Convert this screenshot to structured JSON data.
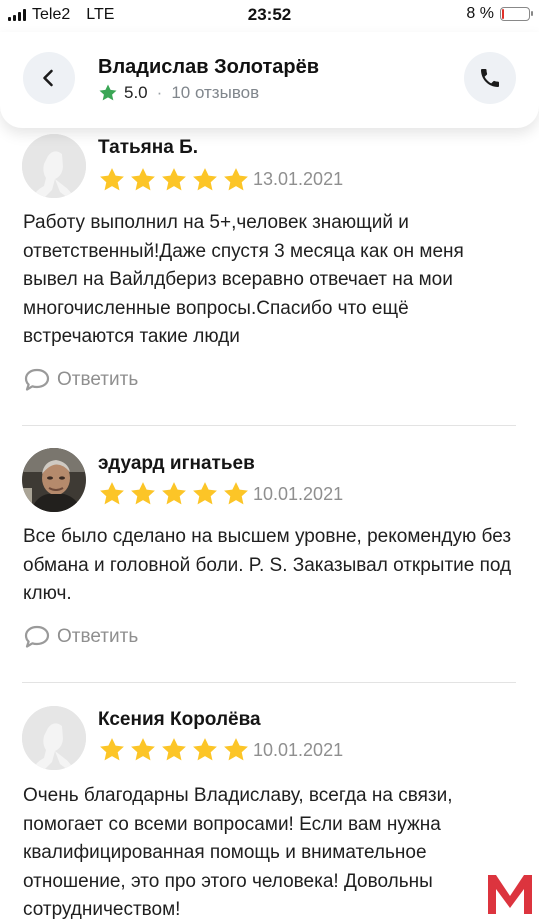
{
  "status_bar": {
    "carrier": "Tele2",
    "network": "LTE",
    "time": "23:52",
    "battery_text": "8 %",
    "battery_level": 0.08,
    "battery_color": "#e0312a"
  },
  "header": {
    "name": "Владислав Золотарёв",
    "rating": "5.0",
    "separator": "·",
    "reviews_count": "10 отзывов",
    "back_icon": "chevron-left-icon",
    "call_icon": "phone-icon"
  },
  "colors": {
    "star": "#fcc527",
    "rating_star": "#3aa655",
    "muted_text": "#8f8f8f"
  },
  "reviews": [
    {
      "name": "Татьяна Б.",
      "stars": 5,
      "date": "13.01.2021",
      "text": "Работу выполнил на 5+,человек знающий и ответственный!Даже спустя 3 месяца как он меня вывел на Вайлдбериз всеравно отвечает на мои многочисленные вопросы.Спасибо что ещё встречаются такие люди",
      "reply_label": "Ответить",
      "avatar": "placeholder"
    },
    {
      "name": "эдуард игнатьев",
      "stars": 5,
      "date": "10.01.2021",
      "text": "Все было сделано на высшем уровне, рекомендую без обмана и головной боли. P. S. Заказывал открытие под ключ.",
      "reply_label": "Ответить",
      "avatar": "photo"
    },
    {
      "name": "Ксения Королёва",
      "stars": 5,
      "date": "10.01.2021",
      "text": "Очень благодарны Владиславу, всегда на связи, помогает со всеми вопросами! Если вам нужна квалифицированная помощь и внимательное отношение, это про этого человека! Довольны сотрудничеством!",
      "reply_label": "Ответить",
      "avatar": "placeholder"
    }
  ],
  "watermark": {
    "letter": "M",
    "color": "#d9232e"
  }
}
